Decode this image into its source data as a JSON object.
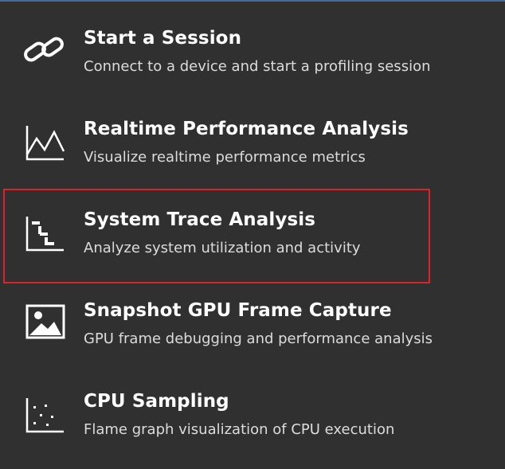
{
  "menu": {
    "items": [
      {
        "title": "Start a Session",
        "description": "Connect to a device and start a profiling session",
        "icon": "link-icon"
      },
      {
        "title": "Realtime Performance Analysis",
        "description": "Visualize realtime performance metrics",
        "icon": "line-chart-icon"
      },
      {
        "title": "System Trace Analysis",
        "description": "Analyze system utilization and activity",
        "icon": "trace-steps-icon"
      },
      {
        "title": "Snapshot GPU Frame Capture",
        "description": "GPU frame debugging and performance analysis",
        "icon": "image-icon"
      },
      {
        "title": "CPU Sampling",
        "description": "Flame graph visualization of CPU execution",
        "icon": "scatter-plot-icon"
      }
    ],
    "highlighted_item": "System Trace Analysis"
  },
  "colors": {
    "background": "#303031",
    "title_text": "#ffffff",
    "description_text": "#dcdcdc",
    "highlight_border": "#e0202a",
    "top_border": "#3a6ea5"
  }
}
